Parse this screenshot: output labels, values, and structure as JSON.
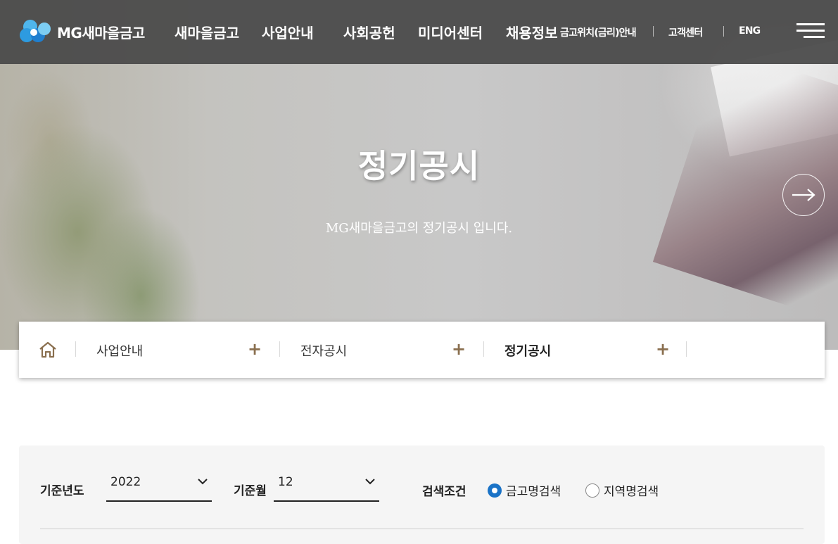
{
  "header": {
    "logo_text": "MG새마을금고",
    "nav": [
      "새마을금고",
      "사업안내",
      "사회공헌",
      "미디어센터",
      "채용정보"
    ],
    "location_link": "금고위치(금리)안내",
    "customer_center": "고객센터",
    "lang": "ENG",
    "menu_icon": "hamburger-icon"
  },
  "hero": {
    "title": "정기공시",
    "subtitle": "MG새마을금고의 정기공시 입니다.",
    "next_icon": "arrow-right-icon"
  },
  "breadcrumb": {
    "home_icon": "home-icon",
    "items": [
      "사업안내",
      "전자공시",
      "정기공시"
    ],
    "expand_symbol": "+"
  },
  "search": {
    "year_label": "기준년도",
    "year_value": "2022",
    "month_label": "기준월",
    "month_value": "12",
    "condition_label": "검색조건",
    "options": [
      "금고명검색",
      "지역명검색"
    ],
    "selected_option": "금고명검색"
  },
  "colors": {
    "header_bg": "#484848",
    "accent_brown": "#8a6f4f",
    "radio_blue": "#1a73c7",
    "logo_blue": "#2d9be0"
  }
}
